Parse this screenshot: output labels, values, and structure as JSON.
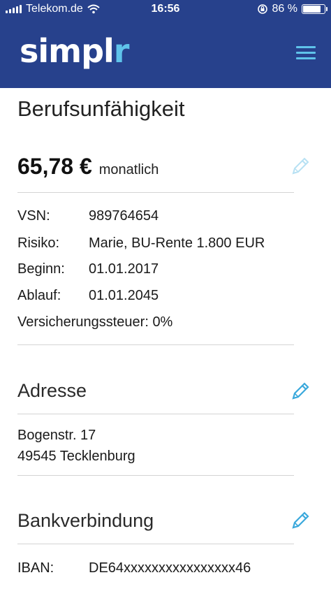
{
  "status_bar": {
    "carrier": "Telekom.de",
    "time": "16:56",
    "battery_percent": "86 %",
    "battery_level": 0.86
  },
  "app": {
    "logo_main": "simpl",
    "logo_accent": "r",
    "menu_icon": "hamburger-menu-icon"
  },
  "contract": {
    "title": "Berufsunfähigkeit",
    "price": "65,78 €",
    "period": "monatlich",
    "details": [
      {
        "label": "VSN:",
        "value": "989764654"
      },
      {
        "label": "Risiko:",
        "value": "Marie, BU-Rente 1.800 EUR"
      },
      {
        "label": "Beginn:",
        "value": "01.01.2017"
      },
      {
        "label": "Ablauf:",
        "value": "01.01.2045"
      }
    ],
    "tax": "Versicherungssteuer: 0%"
  },
  "address": {
    "title": "Adresse",
    "street": "Bogenstr. 17",
    "city": "49545 Tecklenburg"
  },
  "bank": {
    "title": "Bankverbindung",
    "iban_label": "IBAN:",
    "iban_value": "DE64xxxxxxxxxxxxxxxx46"
  },
  "colors": {
    "header_bg": "#27418c",
    "accent": "#5fc3ea",
    "edit_icon_disabled": "#b7e1f3"
  }
}
